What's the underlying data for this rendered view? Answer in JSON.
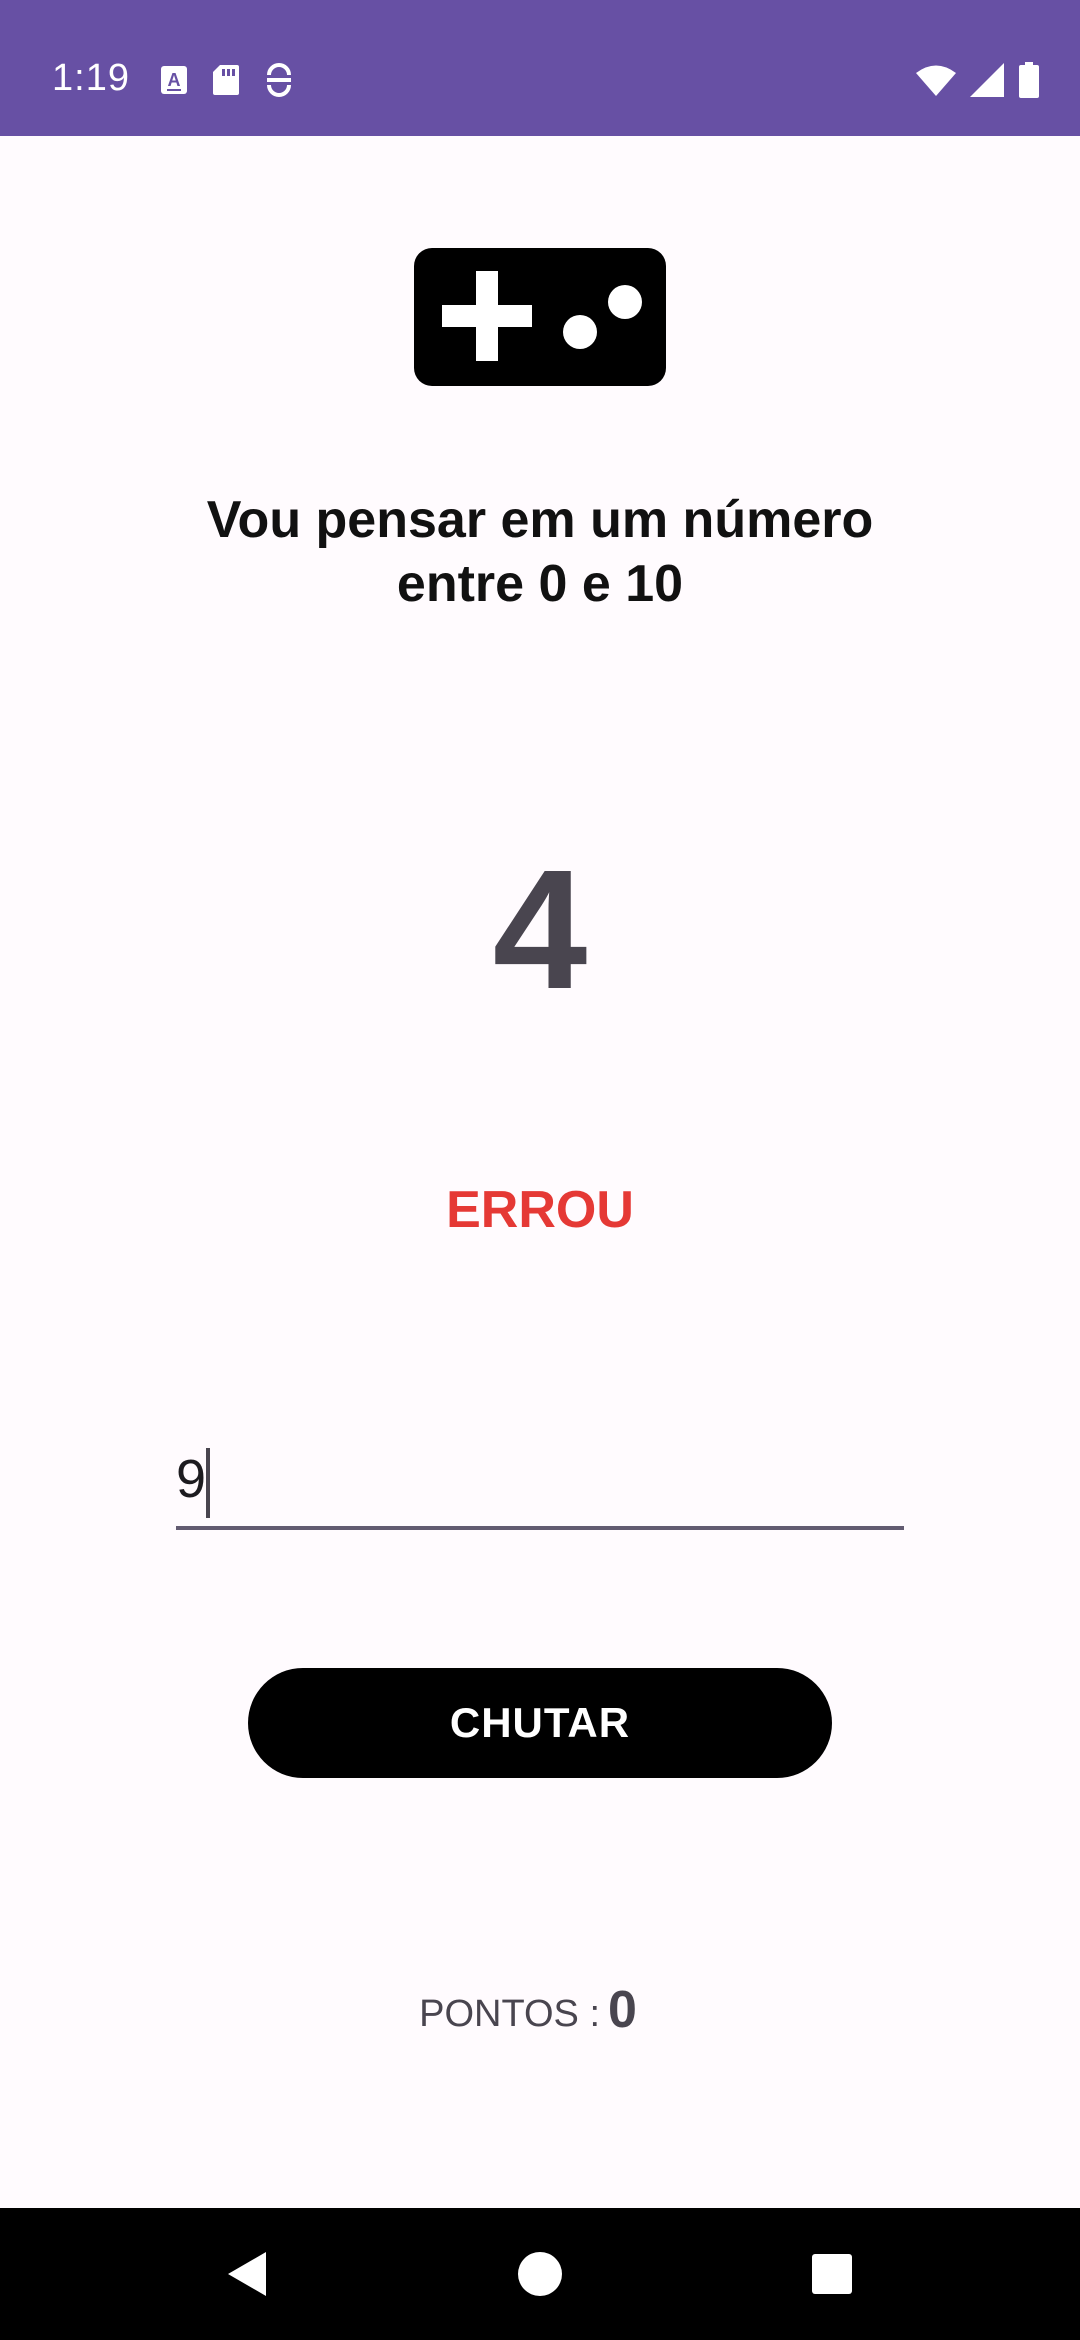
{
  "status_bar": {
    "time": "1:19",
    "background_color": "#6750a4",
    "left_icons": [
      "font-icon",
      "sd-card-icon",
      "sync-icon"
    ],
    "right_icons": [
      "wifi-icon",
      "signal-icon",
      "battery-icon"
    ]
  },
  "header": {
    "icon": "gamepad-icon",
    "prompt_line1": "Vou pensar em um número",
    "prompt_line2": "entre 0 e 10"
  },
  "game": {
    "secret_number": "4",
    "result": "ERROU",
    "result_color": "#e53935"
  },
  "guess": {
    "value": "9",
    "button_label": "CHUTAR"
  },
  "score": {
    "label": "PONTOS :",
    "value": "0"
  },
  "navigation": {
    "buttons": [
      "back-icon",
      "home-icon",
      "recents-icon"
    ]
  }
}
